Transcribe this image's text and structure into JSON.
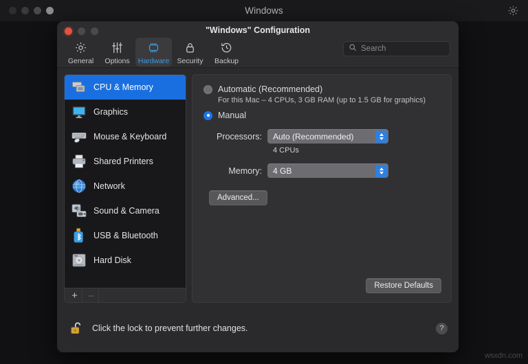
{
  "menubar": {
    "title": "Windows",
    "dots": [
      "#2e2e30",
      "#3a3a3c",
      "#4a4a4c",
      "#8e8e90"
    ],
    "gear_icon": "gear-icon"
  },
  "window": {
    "title": "\"Windows\" Configuration",
    "traffic_lights": [
      "close",
      "minimize",
      "zoom"
    ]
  },
  "toolbar": {
    "tabs": [
      {
        "label": "General",
        "icon": "gear-icon",
        "active": false
      },
      {
        "label": "Options",
        "icon": "sliders-icon",
        "active": false
      },
      {
        "label": "Hardware",
        "icon": "cpu-chip-icon",
        "active": true
      },
      {
        "label": "Security",
        "icon": "lock-icon",
        "active": false
      },
      {
        "label": "Backup",
        "icon": "clock-back-icon",
        "active": false
      }
    ],
    "active_color": "#3d9ae0"
  },
  "search": {
    "placeholder": "Search",
    "value": "",
    "icon": "search-icon"
  },
  "sidebar": {
    "items": [
      {
        "label": "CPU & Memory",
        "icon": "memory-chip-icon",
        "selected": true
      },
      {
        "label": "Graphics",
        "icon": "display-icon",
        "selected": false
      },
      {
        "label": "Mouse & Keyboard",
        "icon": "keyboard-icon",
        "selected": false
      },
      {
        "label": "Shared Printers",
        "icon": "printer-icon",
        "selected": false
      },
      {
        "label": "Network",
        "icon": "globe-icon",
        "selected": false
      },
      {
        "label": "Sound & Camera",
        "icon": "speaker-camera-icon",
        "selected": false
      },
      {
        "label": "USB & Bluetooth",
        "icon": "usb-bluetooth-icon",
        "selected": false
      },
      {
        "label": "Hard Disk",
        "icon": "hard-disk-icon",
        "selected": false
      }
    ],
    "selection_color": "#1a6fe0",
    "add_button": "+",
    "remove_button": "–"
  },
  "content": {
    "automatic": {
      "label": "Automatic (Recommended)",
      "selected": false,
      "description": "For this Mac – 4 CPUs, 3 GB RAM (up to 1.5 GB for graphics)"
    },
    "manual": {
      "label": "Manual",
      "selected": true
    },
    "processors": {
      "label": "Processors:",
      "value": "Auto (Recommended)",
      "note": "4 CPUs"
    },
    "memory": {
      "label": "Memory:",
      "value": "4 GB"
    },
    "advanced_button": "Advanced...",
    "restore_button": "Restore Defaults"
  },
  "footer": {
    "lock_icon": "unlocked-padlock-icon",
    "lock_text": "Click the lock to prevent further changes.",
    "help_button": "?"
  },
  "watermark": "wsxdn.com"
}
